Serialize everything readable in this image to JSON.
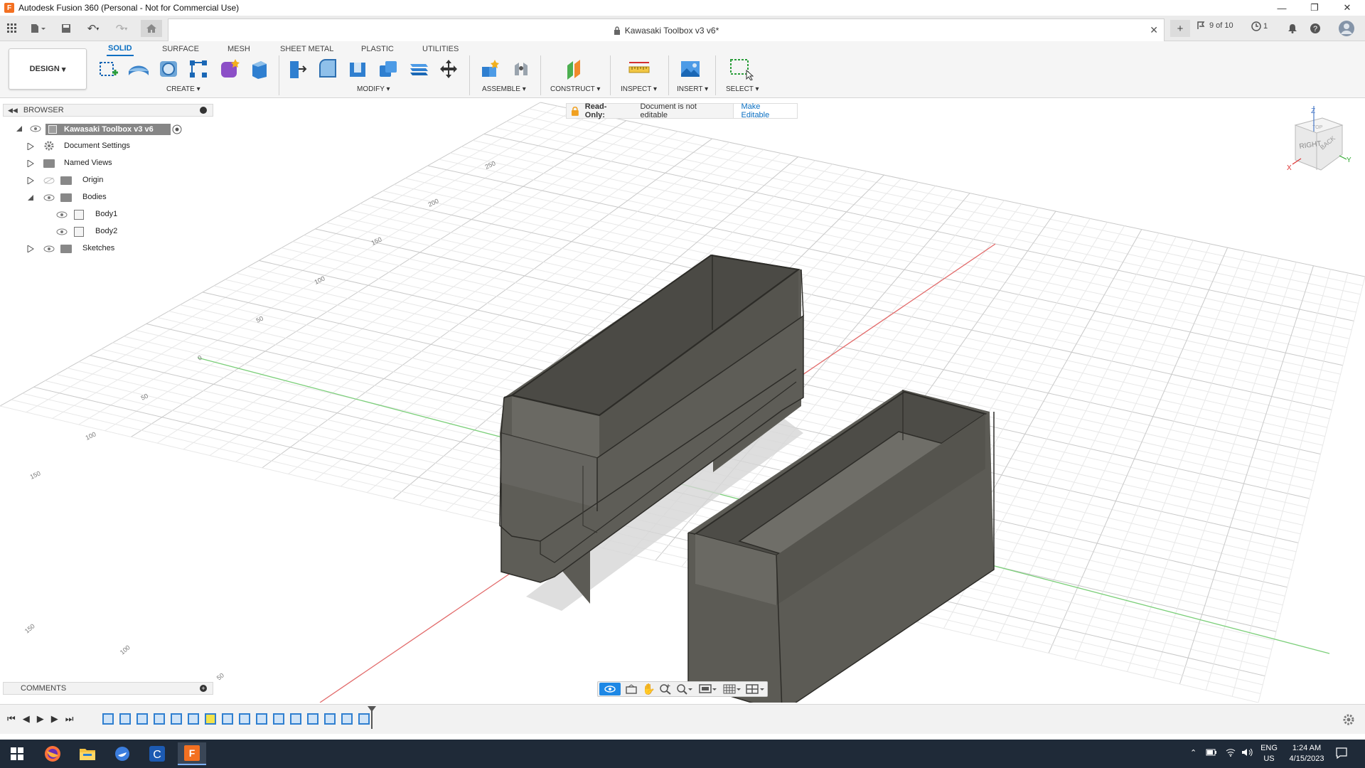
{
  "window": {
    "title": "Autodesk Fusion 360 (Personal - Not for Commercial Use)"
  },
  "appbar": {
    "document_title": "Kawasaki Toolbox v3 v6*",
    "job_status": "9 of 10",
    "clock_count": "1"
  },
  "ribbon": {
    "tabs": [
      "SOLID",
      "SURFACE",
      "MESH",
      "SHEET METAL",
      "PLASTIC",
      "UTILITIES"
    ],
    "active_tab": "SOLID",
    "workspace": "DESIGN",
    "groups": [
      "CREATE",
      "MODIFY",
      "ASSEMBLE",
      "CONSTRUCT",
      "INSPECT",
      "INSERT",
      "SELECT"
    ]
  },
  "browser": {
    "header": "BROWSER",
    "root": "Kawasaki Toolbox v3 v6",
    "items": [
      "Document Settings",
      "Named Views",
      "Origin",
      "Bodies",
      "Body1",
      "Body2",
      "Sketches"
    ]
  },
  "readonly": {
    "label": "Read-Only:",
    "message": "Document is not editable",
    "action": "Make Editable"
  },
  "viewcube": {
    "right": "RIGHT",
    "back": "BACK",
    "top": "TOP",
    "z": "Z",
    "x": "X",
    "y": "Y"
  },
  "grid_labels": [
    "250",
    "200",
    "150",
    "100",
    "50",
    "0",
    "50",
    "100",
    "150",
    "150",
    "100",
    "50"
  ],
  "comments": {
    "label": "COMMENTS"
  },
  "taskbar": {
    "lang": "ENG",
    "region": "US",
    "time": "1:24 AM",
    "date": "4/15/2023"
  },
  "colors": {
    "accent": "#0a6fc2",
    "body": "#5a5953",
    "taskbar": "#1f2a38",
    "fusion": "#f37021"
  }
}
